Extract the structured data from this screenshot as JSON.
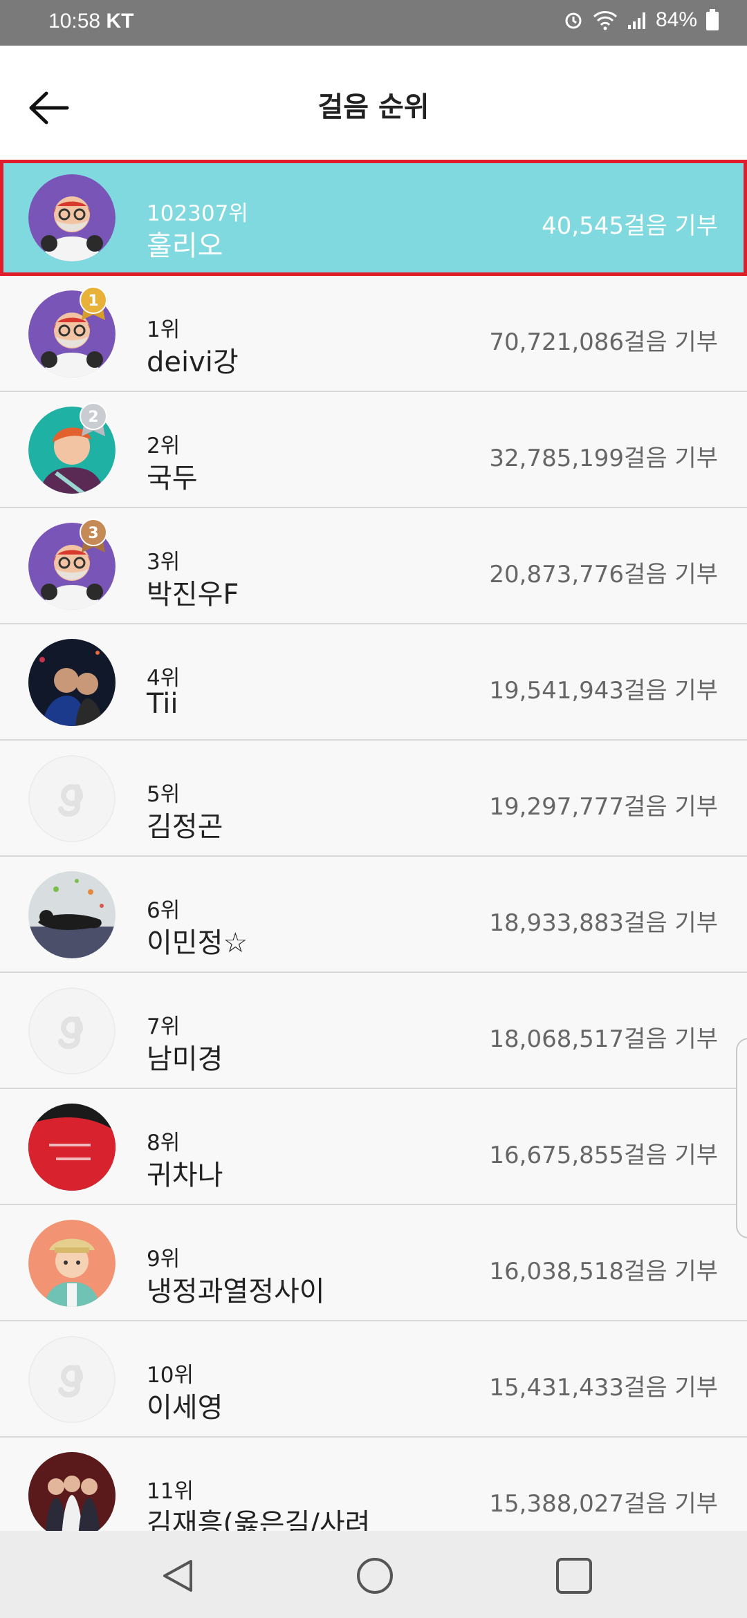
{
  "status_bar": {
    "time": "10:58",
    "carrier": "KT",
    "battery": "84%"
  },
  "header": {
    "title": "걸음 순위",
    "back_icon": "back-arrow-icon"
  },
  "my_rank": {
    "rank": "102307위",
    "name": "훌리오",
    "steps": "40,545걸음 기부",
    "avatar": "bearded-man-avatar"
  },
  "ranking": [
    {
      "rank": "1위",
      "name": "deivi강",
      "steps": "70,721,086걸음 기부",
      "medal": "1",
      "avatar": "bearded-man-avatar"
    },
    {
      "rank": "2위",
      "name": "국두",
      "steps": "32,785,199걸음 기부",
      "medal": "2",
      "avatar": "orange-hair-avatar"
    },
    {
      "rank": "3위",
      "name": "박진우F",
      "steps": "20,873,776걸음 기부",
      "medal": "3",
      "avatar": "bearded-man-avatar"
    },
    {
      "rank": "4위",
      "name": " Tii",
      "steps": "19,541,943걸음 기부",
      "avatar": "photo-avatar"
    },
    {
      "rank": "5위",
      "name": "김정곤",
      "steps": "19,297,777걸음 기부",
      "avatar": "default-avatar"
    },
    {
      "rank": "6위",
      "name": "이민정☆",
      "steps": "18,933,883걸음 기부",
      "avatar": "cat-photo-avatar"
    },
    {
      "rank": "7위",
      "name": "남미경",
      "steps": "18,068,517걸음 기부",
      "avatar": "default-avatar"
    },
    {
      "rank": "8위",
      "name": "귀차나",
      "steps": "16,675,855걸음 기부",
      "avatar": "red-shirt-photo-avatar"
    },
    {
      "rank": "9위",
      "name": "냉정과열정사이",
      "steps": "16,038,518걸음 기부",
      "avatar": "hiker-avatar"
    },
    {
      "rank": "10위",
      "name": "이세영",
      "steps": "15,431,433걸음 기부",
      "avatar": "default-avatar"
    },
    {
      "rank": "11위",
      "name": "김재흥(옳은길/사려",
      "steps": "15,388,027걸음 기부",
      "avatar": "group-photo-avatar"
    }
  ],
  "colors": {
    "highlight": "#80d9df",
    "highlight_border": "#e01d2a",
    "gold": "#e8b23a",
    "silver": "#c9cdd2",
    "bronze": "#c58a55"
  },
  "nav": {
    "back": "nav-back-icon",
    "home": "nav-home-icon",
    "recents": "nav-recents-icon"
  }
}
